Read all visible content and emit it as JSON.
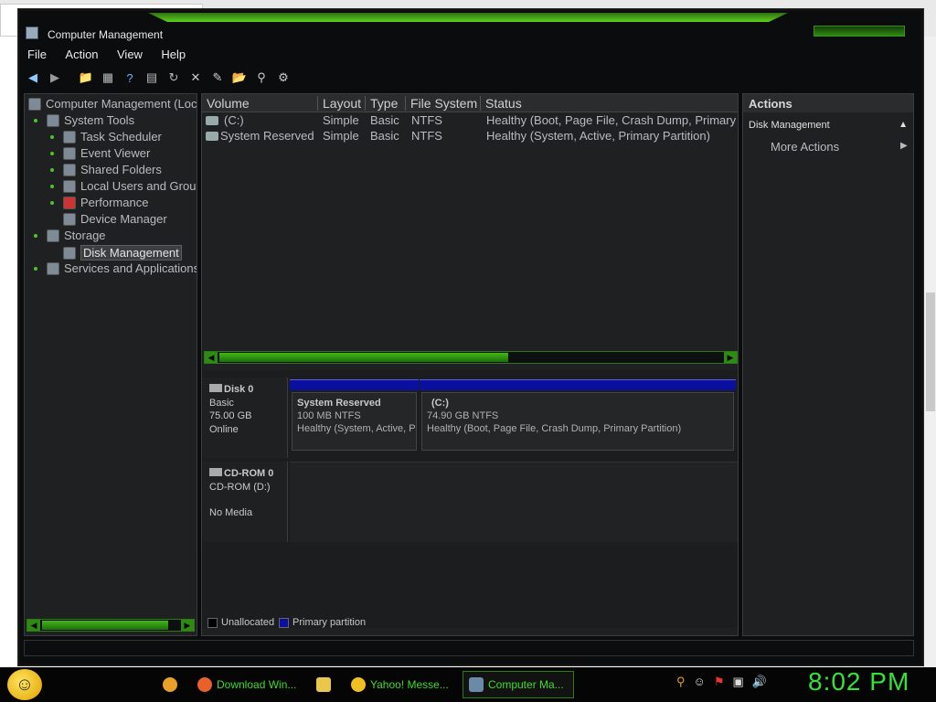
{
  "window": {
    "title": "Computer Management"
  },
  "menu": [
    "File",
    "Action",
    "View",
    "Help"
  ],
  "toolbar": [
    "back-icon",
    "forward-icon",
    "folder-up-icon",
    "show-hide-tree-icon",
    "help-icon",
    "properties-icon",
    "refresh-icon",
    "delete-icon",
    "wizard-icon",
    "open-icon",
    "search-icon",
    "settings-icon"
  ],
  "tree": {
    "root": "Computer Management (Loc",
    "system_tools": "System Tools",
    "task_scheduler": "Task Scheduler",
    "event_viewer": "Event Viewer",
    "shared_folders": "Shared Folders",
    "local_users": "Local Users and Grou",
    "performance": "Performance",
    "device_manager": "Device Manager",
    "storage": "Storage",
    "disk_management": "Disk Management",
    "services": "Services and Applications"
  },
  "volumes": {
    "columns": [
      "Volume",
      "Layout",
      "Type",
      "File System",
      "Status"
    ],
    "rows": [
      [
        "(C:)",
        "Simple",
        "Basic",
        "NTFS",
        "Healthy (Boot, Page File, Crash Dump, Primary"
      ],
      [
        "System Reserved",
        "Simple",
        "Basic",
        "NTFS",
        "Healthy (System, Active, Primary Partition)"
      ]
    ]
  },
  "disk0": {
    "name": "Disk 0",
    "type": "Basic",
    "size": "75.00 GB",
    "state": "Online",
    "partitions": [
      {
        "name": "System Reserved",
        "size": "100 MB NTFS",
        "status": "Healthy (System, Active, P"
      },
      {
        "name": "(C:)",
        "size": "74.90 GB NTFS",
        "status": "Healthy (Boot, Page File, Crash Dump, Primary Partition)"
      }
    ]
  },
  "cdrom0": {
    "name": "CD-ROM 0",
    "drive": "CD-ROM (D:)",
    "state": "No Media"
  },
  "legend": [
    {
      "label": "Unallocated",
      "color": "#000000"
    },
    {
      "label": "Primary partition",
      "color": "#0a0fa0"
    }
  ],
  "actions": {
    "header": "Actions",
    "section": "Disk Management",
    "more": "More Actions"
  },
  "taskbar": {
    "items": [
      {
        "label": "",
        "icon": "chrome-icon",
        "color": "#e8a02a"
      },
      {
        "label": "Download Win...",
        "icon": "firefox-icon",
        "color": "#e8602a"
      },
      {
        "label": "",
        "icon": "folder-icon",
        "color": "#e8c84a"
      },
      {
        "label": "Yahoo! Messe...",
        "icon": "yahoo-messenger-icon",
        "color": "#f0c020"
      },
      {
        "label": "Computer Ma...",
        "icon": "computer-management-icon",
        "color": "#6a8aa8"
      }
    ],
    "tray": [
      "search-icon",
      "messenger-tray-icon",
      "flag-icon",
      "network-icon",
      "volume-icon"
    ],
    "clock": "8:02 PM"
  },
  "colors": {
    "accent": "#38e03a",
    "primary_partition": "#0a0fa0"
  }
}
